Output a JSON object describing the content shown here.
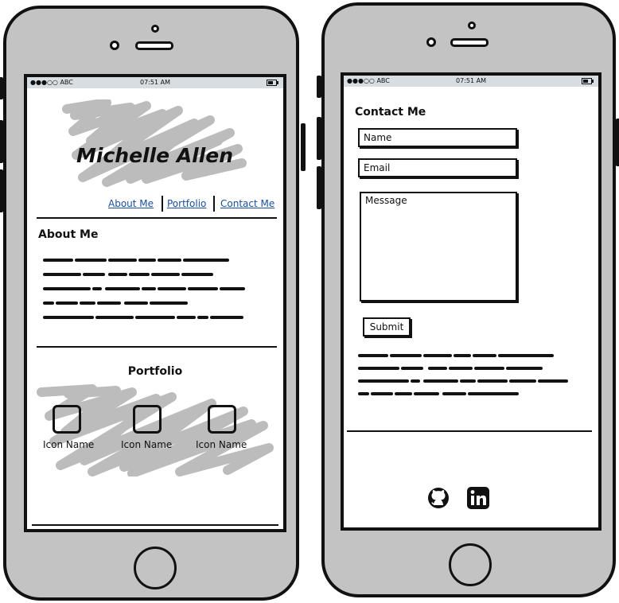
{
  "left_phone": {
    "status": {
      "carrier": "●●●○○ ABC",
      "time": "07:51 AM"
    },
    "name": "Michelle Allen",
    "nav": {
      "about": "About Me",
      "portfolio": "Portfolio",
      "contact": "Contact Me"
    },
    "about_heading": "About Me",
    "portfolio_heading": "Portfolio",
    "portfolio_items": [
      {
        "label": "Icon Name"
      },
      {
        "label": "Icon Name"
      },
      {
        "label": "Icon Name"
      }
    ]
  },
  "right_phone": {
    "status": {
      "carrier": "●●●○○ ABC",
      "time": "07:51 AM"
    },
    "contact_heading": "Contact Me",
    "form": {
      "name_value": "Name",
      "email_value": "Email",
      "message_value": "Message",
      "submit_label": "Submit"
    },
    "social_icons": [
      "github-icon",
      "linkedin-icon"
    ]
  },
  "colors": {
    "phone_body": "#c3c3c3",
    "scribble": "#bcbcbc",
    "link": "#1a4fa0",
    "outline": "#111111"
  }
}
